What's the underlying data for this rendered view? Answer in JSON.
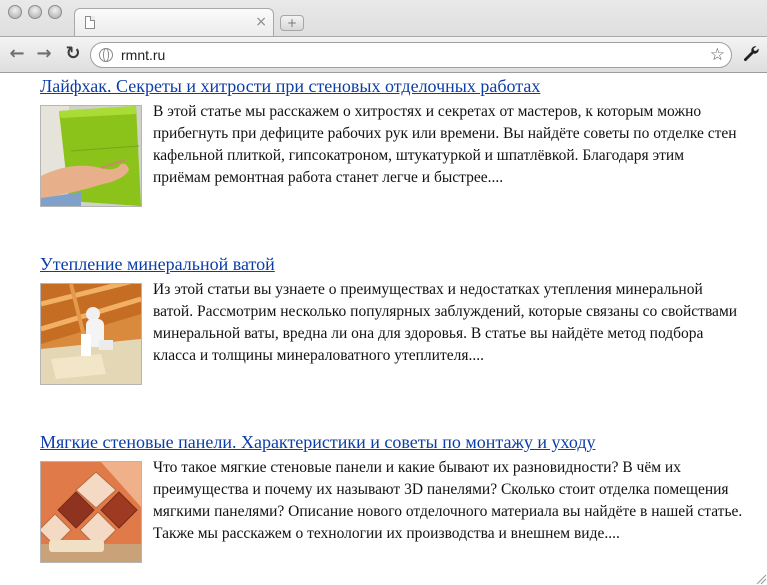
{
  "browser": {
    "url": "rmnt.ru",
    "tab_close_glyph": "×",
    "new_tab_glyph": "+",
    "back_glyph": "←",
    "forward_glyph": "→",
    "reload_glyph": "↻",
    "star_glyph": "☆",
    "wrench_glyph": "🔧"
  },
  "articles": [
    {
      "title": "Лайфхак. Секреты и хитрости при стеновых отделочных работах",
      "excerpt": "В этой статье мы расскажем о хитростях и секретах от мастеров, к которым можно прибегнуть при дефиците рабочих рук или времени. Вы найдёте советы по отделке стен кафельной плиткой, гипсокатроном, штукатуркой и шпатлёвкой. Благодаря этим приёмам ремонтная работа станет легче и быстрее....",
      "thumb_icon": "green-tile-photo"
    },
    {
      "title": "Утепление минеральной ватой",
      "excerpt": "Из этой статьи вы узнаете о преимуществах и недостатках утепления минеральной ватой. Рассмотрим несколько популярных заблуждений, которые связаны со свойствами минеральной ваты, вредна ли она для здоровья. В статье вы найдёте метод подбора класса и толщины минераловатного утеплителя....",
      "thumb_icon": "attic-insulation-photo"
    },
    {
      "title": "Мягкие стеновые панели. Характеристики и советы по монтажу и уходу",
      "excerpt": "Что такое мягкие стеновые панели и какие бывают их разновидности? В чём их преимущества и почему их называют 3D панелями? Сколько стоит отделка помещения мягкими панелями? Описание нового отделочного материала вы найдёте в нашей статье. Также мы расскажем о технологии их производства и внешнем виде....",
      "thumb_icon": "soft-wall-panels-photo"
    }
  ],
  "colors": {
    "link": "#0b3da8",
    "text": "#111111"
  }
}
